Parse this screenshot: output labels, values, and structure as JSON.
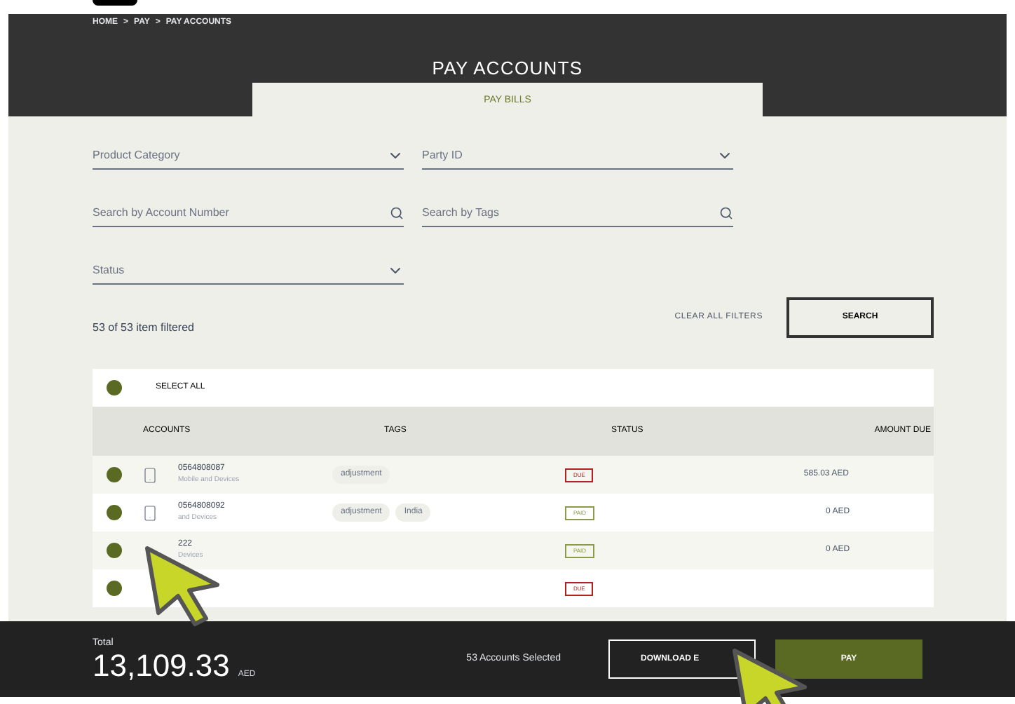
{
  "breadcrumb": [
    "HOME",
    ">",
    "PAY",
    ">",
    "PAY ACCOUNTS"
  ],
  "page_title": "PAY ACCOUNTS",
  "tabs": [
    {
      "label": "PAY BILLS",
      "selected": true
    }
  ],
  "filters": [
    {
      "kind": "select",
      "placeholder": "Product Category"
    },
    {
      "kind": "select",
      "placeholder": "Party ID"
    },
    {
      "kind": "search",
      "placeholder": "Search by Account Number"
    },
    {
      "kind": "search",
      "placeholder": "Search by Tags"
    },
    {
      "kind": "select",
      "placeholder": "Status"
    }
  ],
  "result_count": "53 of 53 item filtered",
  "clear_filters": "CLEAR ALL FILTERS",
  "search_button": "SEARCH",
  "select_all": {
    "label": "SELECT ALL",
    "checked": true
  },
  "table": {
    "columns": [
      "ACCOUNTS",
      "TAGS",
      "STATUS",
      "AMOUNT DUE"
    ],
    "rows": [
      {
        "checked": true,
        "account": "0564808087",
        "category": "Mobile and Devices",
        "tags": [
          "adjustment"
        ],
        "status": "DUE",
        "color": "#b32020",
        "kind": "phone",
        "amount": "585.03 AED"
      },
      {
        "checked": true,
        "account": "0564808092",
        "category": "and Devices",
        "tags": [
          "adjustment",
          "India"
        ],
        "status": "PAID",
        "color": "#8a9a4a",
        "kind": "phone",
        "amount": "0 AED"
      },
      {
        "checked": true,
        "account": "222",
        "category": "Devices",
        "tags": [],
        "status": "PAID",
        "color": "#8a9a4a",
        "kind": "covered",
        "amount": "0 AED"
      },
      {
        "checked": true,
        "tags": [],
        "status": "DUE",
        "color": "#b32020",
        "kind": "covered"
      }
    ]
  },
  "footer": {
    "total_label": "Total",
    "total": "13,109.33",
    "currency": "AED",
    "selected_count": "53 Accounts Selected",
    "download_button": "DOWNLOAD E",
    "pay_button": "PAY"
  }
}
